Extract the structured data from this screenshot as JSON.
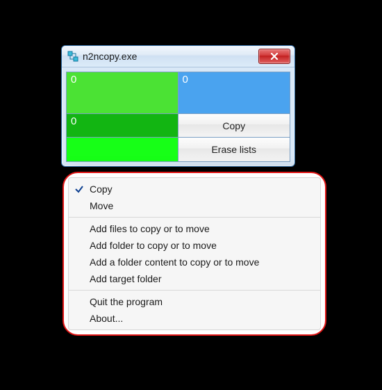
{
  "window": {
    "title": "n2ncopy.exe"
  },
  "panels": {
    "top_left_count": "0",
    "top_right_count": "0",
    "mid_left_count": "0"
  },
  "buttons": {
    "copy": "Copy",
    "erase": "Erase lists"
  },
  "menu": {
    "group1": [
      {
        "label": "Copy",
        "checked": true
      },
      {
        "label": "Move",
        "checked": false
      }
    ],
    "group2": [
      {
        "label": "Add files to copy or to move"
      },
      {
        "label": "Add folder to copy or to move"
      },
      {
        "label": "Add a folder content to copy or to move"
      },
      {
        "label": "Add target folder"
      }
    ],
    "group3": [
      {
        "label": "Quit the program"
      },
      {
        "label": "About..."
      }
    ]
  }
}
